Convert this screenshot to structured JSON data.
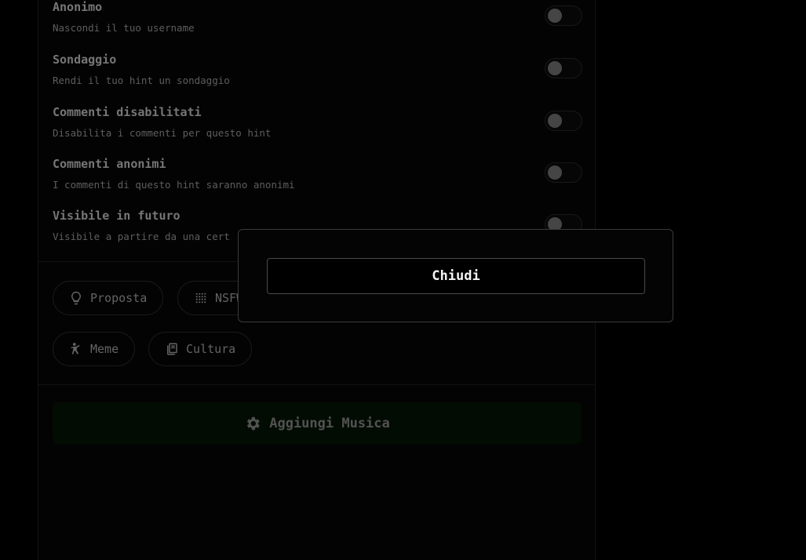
{
  "options": [
    {
      "title": "Anonimo",
      "desc": "Nascondi il tuo username",
      "enabled": false
    },
    {
      "title": "Sondaggio",
      "desc": "Rendi il tuo hint un sondaggio",
      "enabled": false
    },
    {
      "title": "Commenti disabilitati",
      "desc": "Disabilita i commenti per questo hint",
      "enabled": false
    },
    {
      "title": "Commenti anonimi",
      "desc": "I commenti di questo hint saranno anonimi",
      "enabled": false
    },
    {
      "title": "Visibile in futuro",
      "desc": "Visibile a partire da una cert",
      "enabled": false
    }
  ],
  "tags": [
    {
      "label": "Proposta",
      "icon": "lightbulb-icon"
    },
    {
      "label": "NSFW",
      "icon": "grid-dots-icon"
    },
    {
      "label": "Meme",
      "icon": "dancing-figure-icon"
    },
    {
      "label": "Cultura",
      "icon": "book-icon"
    }
  ],
  "music_button": {
    "label": "Aggiungi Musica",
    "icon": "gear-icon"
  },
  "modal": {
    "close_label": "Chiudi"
  }
}
